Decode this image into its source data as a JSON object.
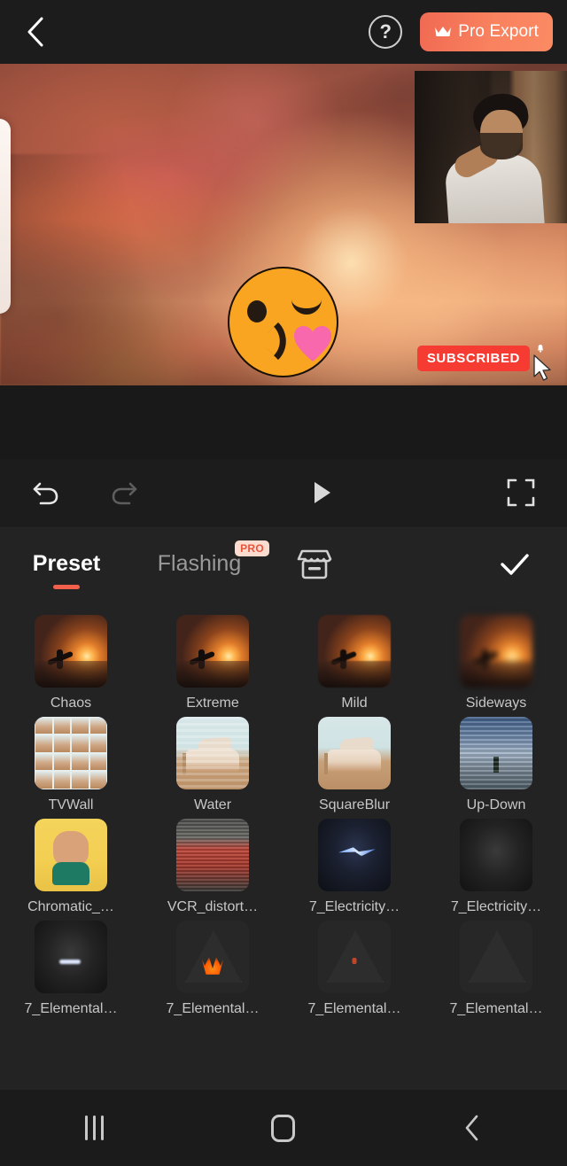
{
  "app": {
    "theme_bg": "#1c1c1c",
    "accent": "#f2604c"
  },
  "topbar": {
    "back_icon": "chevron-left-icon",
    "help_label": "?",
    "help_icon": "help-circle-icon",
    "pro_export_label": "Pro Export",
    "pro_export_icon": "crown-icon",
    "pro_export_color": "#f7805e"
  },
  "preview": {
    "emoji_sticker": "kissing-face-emoji",
    "pip_clip": "person-video-overlay",
    "subscribed_label": "SUBSCRIBED",
    "subscribed_color": "#f63b33",
    "bell_icon": "bell-icon",
    "cursor_icon": "cursor-arrow-icon"
  },
  "playback": {
    "undo_icon": "undo-icon",
    "redo_icon": "redo-icon",
    "play_icon": "play-icon",
    "fullscreen_icon": "fullscreen-icon"
  },
  "tabs": {
    "preset": {
      "label": "Preset",
      "active": true
    },
    "flashing": {
      "label": "Flashing",
      "badge": "PRO",
      "badge_color": "#e8543c"
    },
    "store": {
      "icon": "store-icon"
    },
    "confirm": {
      "icon": "check-icon"
    }
  },
  "effects": [
    {
      "label": "Chaos",
      "thumb": "sunset-surfer"
    },
    {
      "label": "Extreme",
      "thumb": "sunset-surfer"
    },
    {
      "label": "Mild",
      "thumb": "sunset-surfer-soft"
    },
    {
      "label": "Sideways",
      "thumb": "sunset-blurred"
    },
    {
      "label": "TVWall",
      "thumb": "van-grid"
    },
    {
      "label": "Water",
      "thumb": "van-water"
    },
    {
      "label": "SquareBlur",
      "thumb": "van-plain"
    },
    {
      "label": "Up-Down",
      "thumb": "beach-updown"
    },
    {
      "label": "Chromatic_…",
      "thumb": "woman-yellow"
    },
    {
      "label": "VCR_distort…",
      "thumb": "red-tram-vcr"
    },
    {
      "label": "7_Electricity…",
      "thumb": "electric-bolt-blue"
    },
    {
      "label": "7_Electricity…",
      "thumb": "dark-room"
    },
    {
      "label": "7_Elemental…",
      "thumb": "dark-spark"
    },
    {
      "label": "7_Elemental…",
      "thumb": "triangle-flame"
    },
    {
      "label": "7_Elemental…",
      "thumb": "triangle-ember"
    },
    {
      "label": "7_Elemental…",
      "thumb": "triangle-faint"
    }
  ],
  "navbar": {
    "recents_icon": "recents-icon",
    "home_icon": "home-icon",
    "back_icon": "nav-back-icon"
  }
}
